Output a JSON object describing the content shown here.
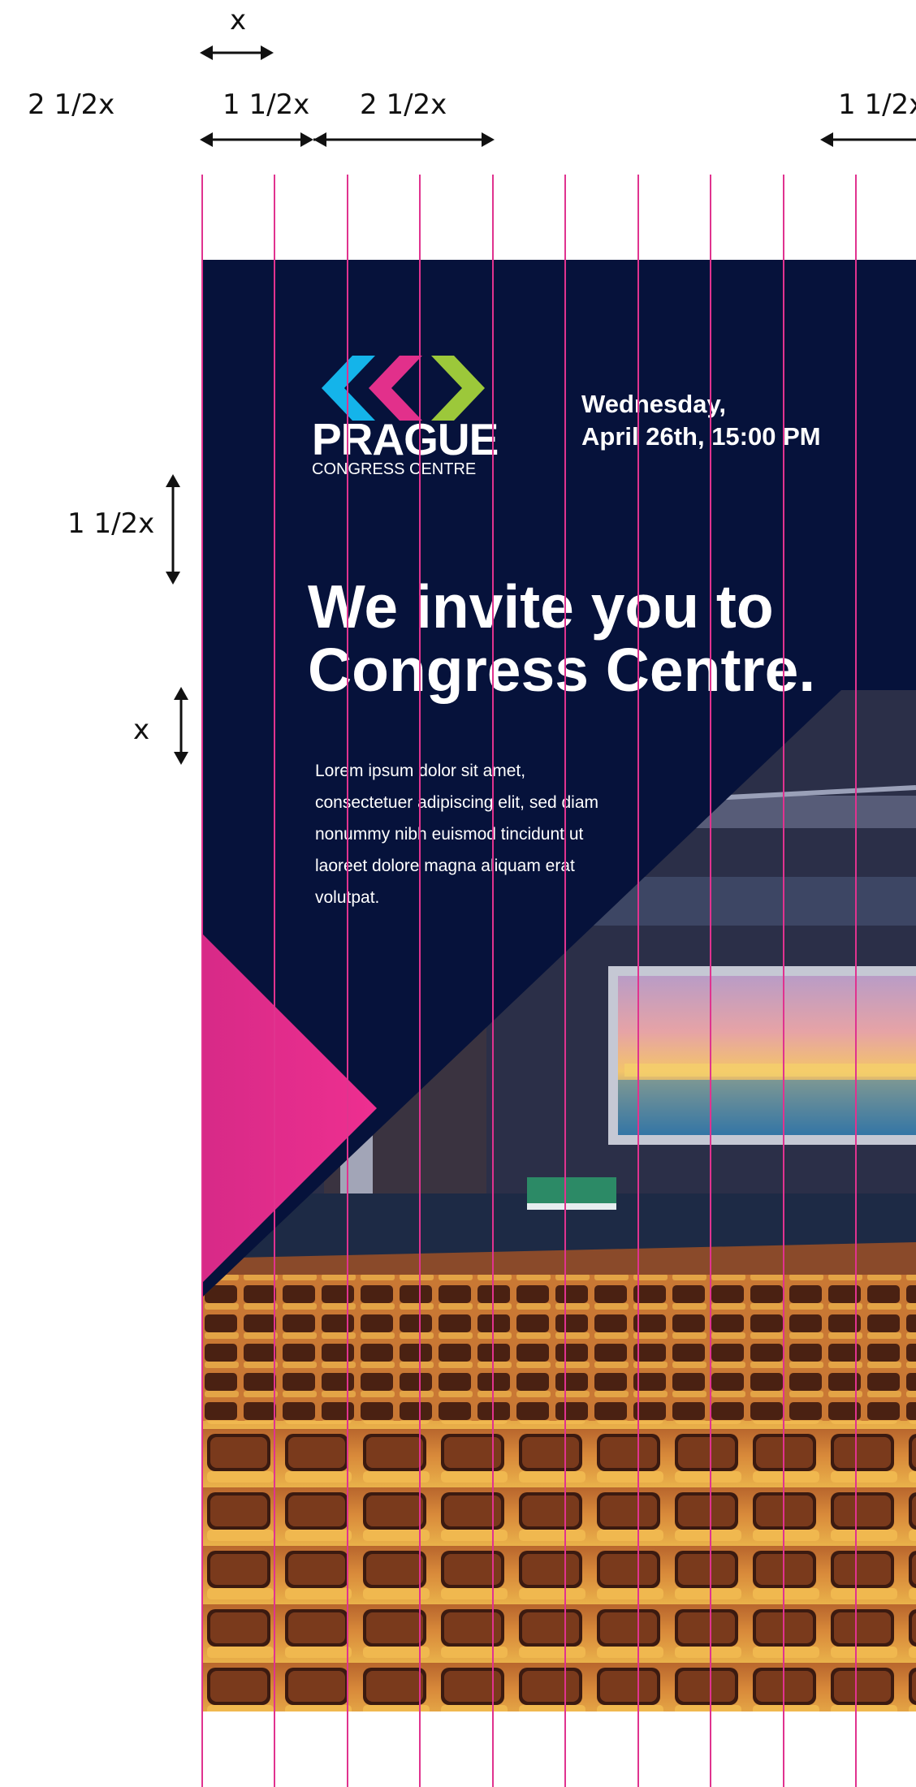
{
  "dimensions": {
    "top_x": "x",
    "left_margin": "2 1/2x",
    "col_one_and_half": "1 1/2x",
    "col_two_and_half": "2 1/2x",
    "right_one_and_half": "1 1/2x",
    "vertical_one_and_half": "1 1/2x",
    "vertical_x": "x"
  },
  "poster": {
    "logo": {
      "wordmark": "PRAGUE",
      "subline": "CONGRESS CENTRE",
      "colors": [
        "#14b4ea",
        "#e2308b",
        "#9cc83a"
      ]
    },
    "date": {
      "line1": "Wednesday,",
      "line2": "April 26th, 15:00 PM"
    },
    "headline": {
      "line1": "We invite you to",
      "line2": "Congress Centre."
    },
    "body": "Lorem ipsum dolor sit amet, consectetuer adipiscing elit, sed diam nonummy nibh euismod tincidunt ut laoreet dolore magna aliquam erat volutpat.",
    "colors": {
      "background": "#06123b",
      "accent": "#e2308b",
      "grid": "#e0338f"
    }
  }
}
